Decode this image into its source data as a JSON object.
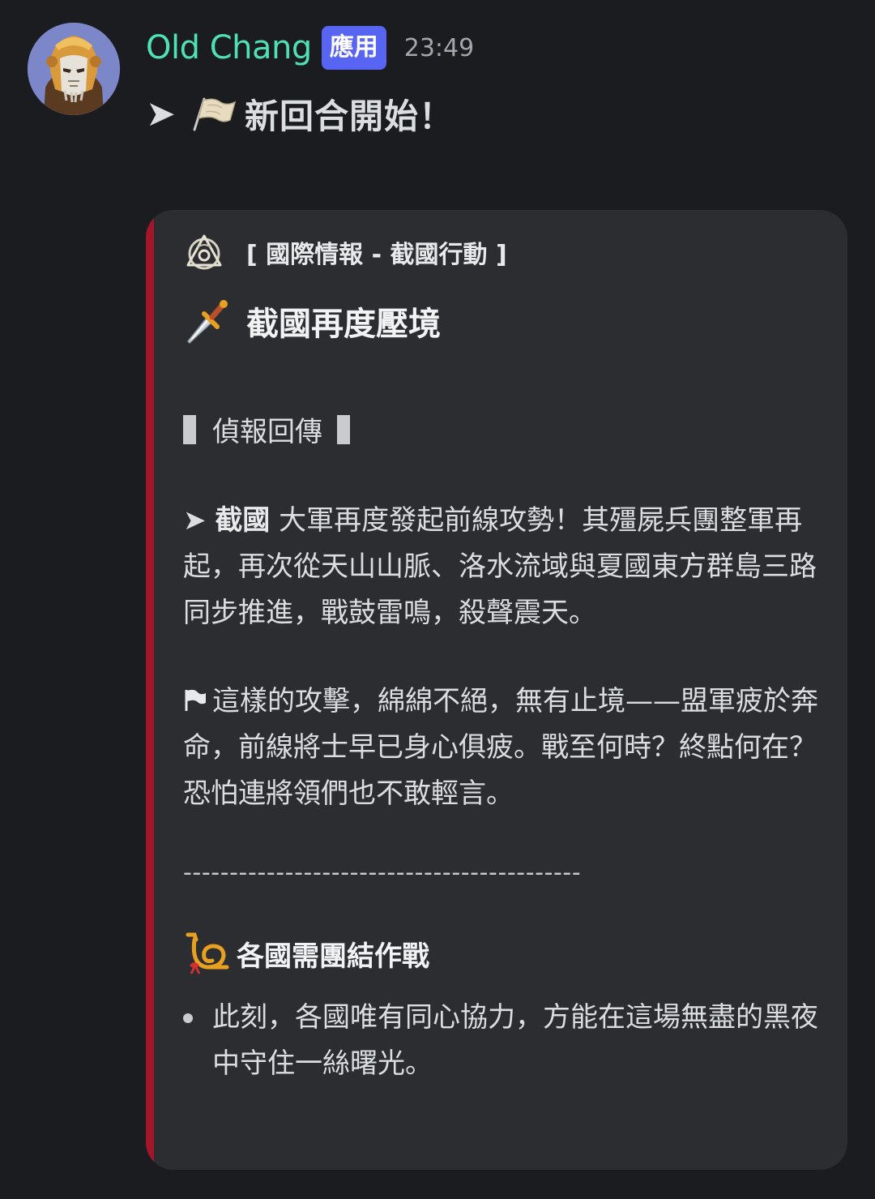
{
  "message": {
    "author": {
      "name": "Old Chang",
      "badge": "應用",
      "timestamp": "23:49",
      "avatar_icon": "armored-knight-avatar",
      "name_color": "#4fe0b4",
      "badge_color": "#5865f2"
    },
    "content": {
      "arrow": "➤",
      "flag_icon": "waving-flag-icon",
      "text": "新回合開始！"
    }
  },
  "embed": {
    "accent_color": "#a3162a",
    "author": {
      "icon": "triangle-crest-icon",
      "name": "[ 國際情報 - 截國行動 ]"
    },
    "title": {
      "icon": "dagger-icon",
      "text": "截國再度壓境"
    },
    "section_heading": "偵報回傳",
    "paragraph1": {
      "arrow": "➤",
      "bold": "截國",
      "text": " 大軍再度發起前線攻勢！其殭屍兵團整軍再起，再次從天山山脈、洛水流域與夏國東方群島三路同步推進，戰鼓雷鳴，殺聲震天。"
    },
    "paragraph2": {
      "flag_icon": "flag-icon",
      "text": "這樣的攻擊，綿綿不絕，無有止境——盟軍疲於奔命，前線將士早已身心俱疲。戰至何時？終點何在？恐怕連將領們也不敢輕言。"
    },
    "divider": "-------------------------------------------",
    "field": {
      "icon": "postal-horn-icon",
      "title": "各國需團結作戰",
      "bullets": [
        "此刻，各國唯有同心協力，方能在這場無盡的黑夜中守住一絲曙光。"
      ]
    }
  }
}
